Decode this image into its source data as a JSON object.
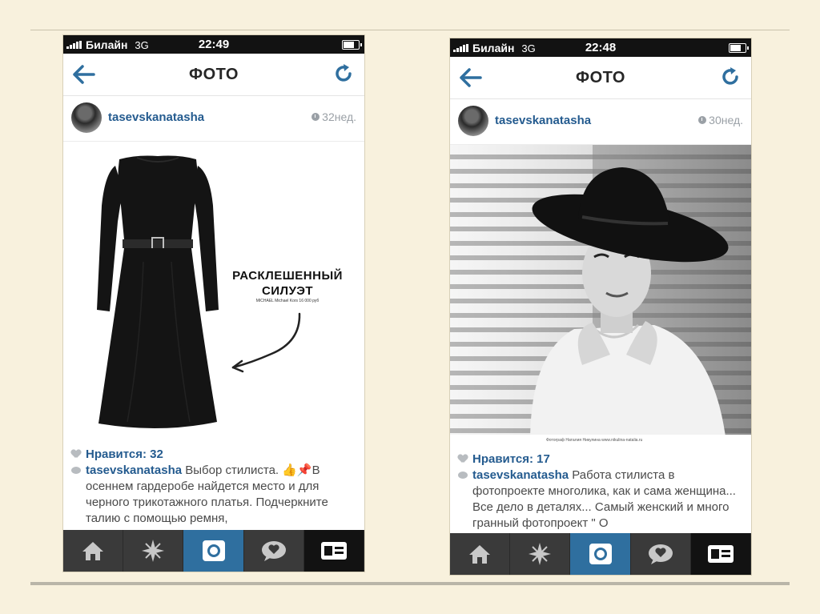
{
  "phones": [
    {
      "status": {
        "carrier": "Билайн",
        "network": "3G",
        "time": "22:49"
      },
      "nav": {
        "title": "ФОТО"
      },
      "post": {
        "username": "tasevskanatasha",
        "age": "32нед.",
        "overlay_title_line1": "РАСКЛЕШЕННЫЙ",
        "overlay_title_line2": "СИЛУЭТ",
        "overlay_subtitle": "MICHAEL Michael Kors 16 000 руб",
        "likes": "Нравится: 32",
        "caption_user": "tasevskanatasha",
        "caption_text": " Выбор стилиста. 👍📌В осеннем гардеробе найдется место и для черного трикотажного платья. Подчеркните талию с помощью ремня,"
      }
    },
    {
      "status": {
        "carrier": "Билайн",
        "network": "3G",
        "time": "22:48"
      },
      "nav": {
        "title": "ФОТО"
      },
      "post": {
        "username": "tasevskanatasha",
        "age": "30нед.",
        "photo_credit": "Фотограф Наталия Никулина www.nikulina-natalia.ru",
        "likes": "Нравится: 17",
        "caption_user": "tasevskanatasha",
        "caption_text": " Работа стилиста в фотопроекте многолика, как и сама женщина... Все дело в деталях... Самый женский и много гранный фотопроект \" О"
      }
    }
  ],
  "tabbar_icons": [
    "home-icon",
    "explore-icon",
    "camera-icon",
    "activity-icon",
    "profile-icon"
  ],
  "colors": {
    "accent": "#2f6f9f",
    "link": "#245b8f",
    "tabbar": "#3a3a3a",
    "background": "#f8f1dd"
  }
}
